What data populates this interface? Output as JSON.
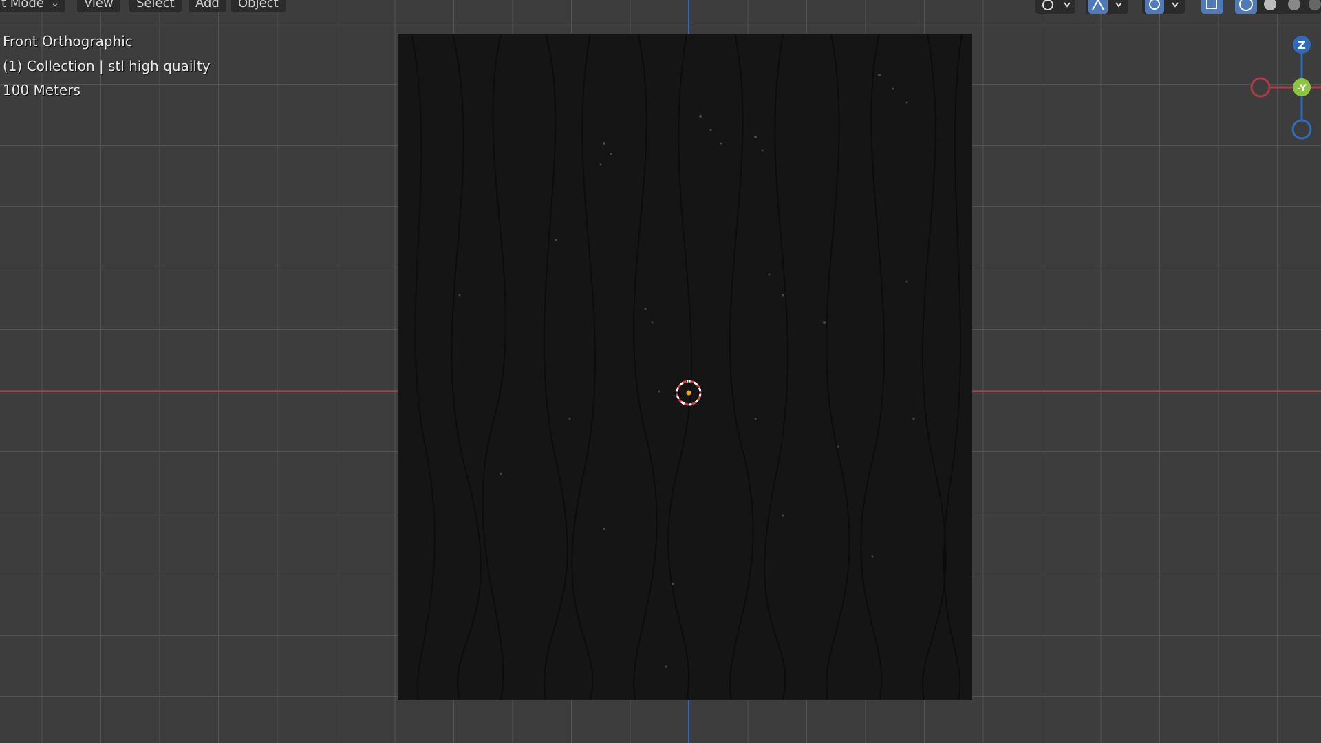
{
  "header": {
    "mode_label": "t Mode",
    "menus": [
      "View",
      "Select",
      "Add",
      "Object"
    ]
  },
  "viewport": {
    "view_name": "Front Orthographic",
    "collection_info": "(1) Collection | stl high quailty",
    "scale": "100 Meters"
  },
  "gizmo": {
    "z_label": "Z",
    "y_label": "-Y"
  },
  "colors": {
    "x_axis": "#b23a48",
    "z_axis": "#2f6bb8",
    "grid_bg": "#3d3d3d",
    "mesh": "#151515"
  },
  "icons": {
    "toolbar": [
      "view-object-types-icon",
      "gizmo-icon",
      "overlays-icon",
      "xray-icon",
      "wireframe-icon",
      "solid-shading-icon",
      "material-preview-icon",
      "rendered-icon"
    ]
  }
}
